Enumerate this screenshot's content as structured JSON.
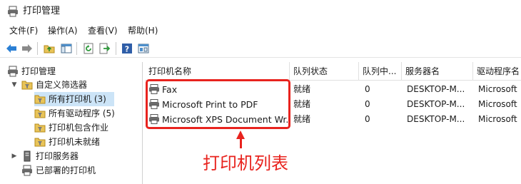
{
  "window": {
    "title": "打印管理"
  },
  "menu": [
    "文件(F)",
    "操作(A)",
    "查看(V)",
    "帮助(H)"
  ],
  "toolbar": {
    "buttons": [
      "back-icon",
      "forward-icon",
      "up-folder-icon",
      "show-tree-icon",
      "refresh-icon",
      "export-icon",
      "help-icon",
      "properties-icon"
    ]
  },
  "tree": {
    "root": "打印管理",
    "custom_filters": "自定义筛选器",
    "filters": [
      "所有打印机 (3)",
      "所有驱动程序 (5)",
      "打印机包含作业",
      "打印机未就绪"
    ],
    "print_servers": "打印服务器",
    "deployed_printers": "已部署的打印机"
  },
  "columns": [
    "打印机名称",
    "队列状态",
    "队列中...",
    "服务器名",
    "驱动程序名"
  ],
  "printers": [
    {
      "name": "Fax",
      "status": "就绪",
      "jobs": "0",
      "server": "DESKTOP-M...",
      "driver": "Microsoft"
    },
    {
      "name": "Microsoft Print to PDF",
      "status": "就绪",
      "jobs": "0",
      "server": "DESKTOP-M...",
      "driver": "Microsoft"
    },
    {
      "name": "Microsoft XPS Document Wr...",
      "status": "就绪",
      "jobs": "0",
      "server": "DESKTOP-M...",
      "driver": "Microsoft"
    }
  ],
  "annotation": "打印机列表",
  "colors": {
    "annotation": "#e8231e",
    "selection": "#cce4f7"
  }
}
